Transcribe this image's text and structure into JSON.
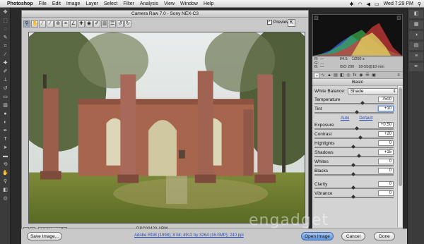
{
  "menubar": {
    "app": "Photoshop",
    "items": [
      "File",
      "Edit",
      "Image",
      "Layer",
      "Select",
      "Filter",
      "Analysis",
      "View",
      "Window",
      "Help"
    ],
    "clock": "Wed 7:29 PM"
  },
  "dialog": {
    "title": "Camera Raw 7.0  -  Sony NEX-C3",
    "preview_label": "Preview",
    "preview_checked": true
  },
  "image": {
    "filename": "DSC00423.ARW",
    "zoom": "16.8%"
  },
  "readout": {
    "r_label": "R:",
    "g_label": "G:",
    "b_label": "B:",
    "r": "---",
    "g": "---",
    "b": "---",
    "aperture": "f/4.5",
    "shutter": "1/250 s",
    "iso": "ISO 200",
    "lens": "18-55@18 mm"
  },
  "panel": {
    "title": "Basic",
    "white_balance_label": "White Balance:",
    "white_balance_value": "Shade",
    "auto": "Auto",
    "default": "Default",
    "sliders": [
      {
        "label": "Temperature",
        "value": "7500",
        "level": 0.62
      },
      {
        "label": "Tint",
        "value": "+10",
        "level": 0.55,
        "highlight": true
      },
      {
        "label": "Exposure",
        "value": "+0.50",
        "level": 0.55
      },
      {
        "label": "Contrast",
        "value": "+20",
        "level": 0.6
      },
      {
        "label": "Highlights",
        "value": "0",
        "level": 0.5
      },
      {
        "label": "Shadows",
        "value": "+15",
        "level": 0.58
      },
      {
        "label": "Whites",
        "value": "0",
        "level": 0.5
      },
      {
        "label": "Blacks",
        "value": "0",
        "level": 0.5
      },
      {
        "label": "Clarity",
        "value": "0",
        "level": 0.5
      },
      {
        "label": "Vibrance",
        "value": "0",
        "level": 0.5
      }
    ]
  },
  "footer": {
    "save": "Save Image...",
    "workflow": "Adobe RGB (1998); 8 bit; 4912 by 3264 (16.0MP); 240 ppi",
    "open": "Open Image",
    "cancel": "Cancel",
    "done": "Done"
  },
  "watermark": "engadget",
  "icons": {
    "apple": "apple-icon",
    "wifi": "wifi-icon",
    "search": "spotlight-icon"
  }
}
